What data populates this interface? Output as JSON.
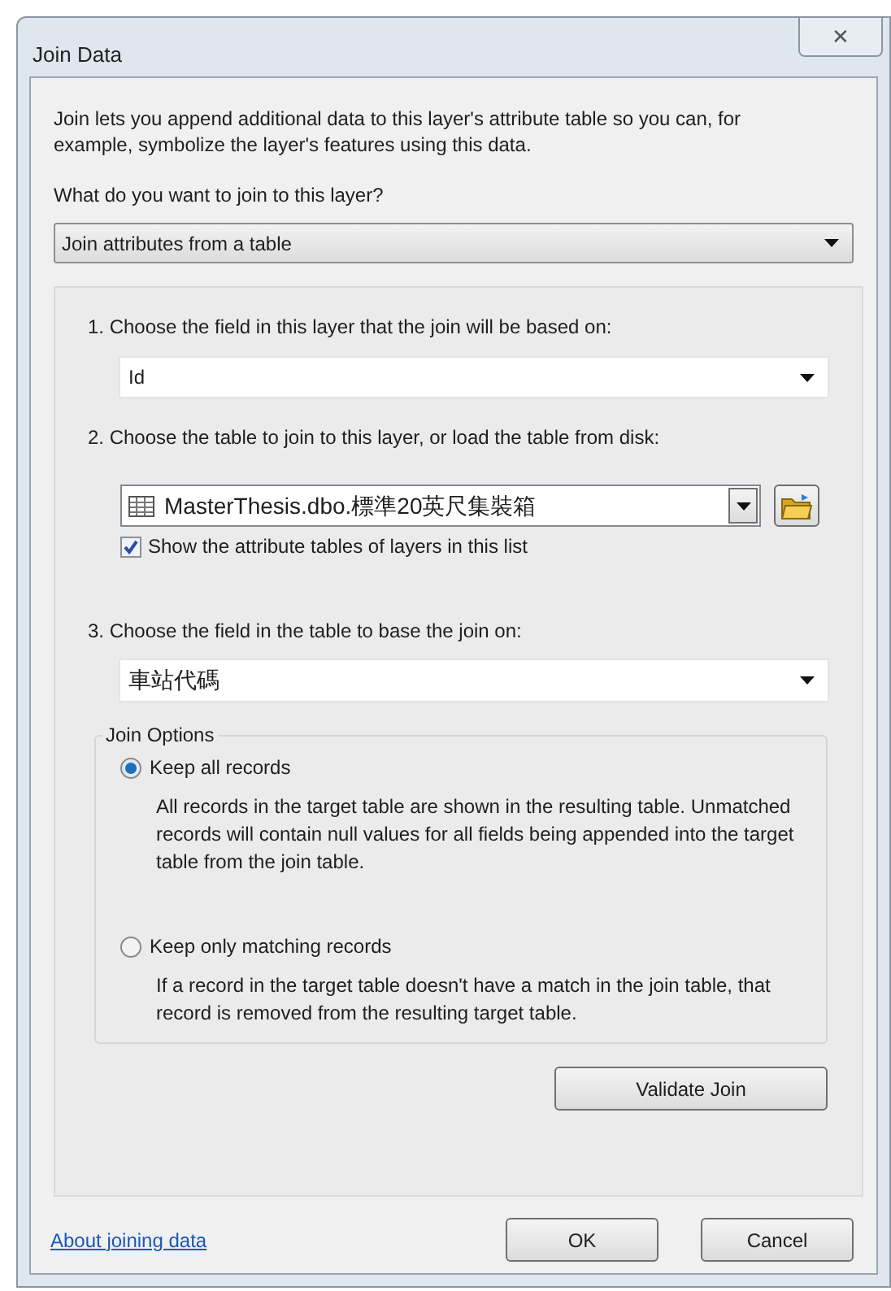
{
  "window": {
    "title": "Join Data",
    "close": "✕"
  },
  "intro": "Join lets you append additional data to this layer's attribute table so you can, for example, symbolize the layer's features using this data.",
  "join_type": {
    "label": "What do you want to join to this layer?",
    "value": "Join attributes from a table"
  },
  "step1": {
    "label": "1.  Choose the field in this layer that the join will be based on:",
    "value": "Id"
  },
  "step2": {
    "label": "2.  Choose the table to join to this layer, or load the table from disk:",
    "value": "MasterThesis.dbo.標準20英尺集裝箱",
    "show_layer_tables": {
      "label": "Show the attribute tables of layers in this list",
      "checked": true
    }
  },
  "step3": {
    "label": "3.  Choose the field in the table to base the join on:",
    "value": "車站代碼"
  },
  "join_options": {
    "title": "Join Options",
    "options": [
      {
        "label": "Keep all records",
        "description": "All records in the target table are shown in the resulting table. Unmatched records will contain null values for all fields being appended into the target table from the join table.",
        "selected": true
      },
      {
        "label": "Keep only matching records",
        "description": "If a record in the target table doesn't have a match in the join table, that record is removed from the resulting target table.",
        "selected": false
      }
    ]
  },
  "validate_button": "Validate Join",
  "help_link": "About joining data",
  "buttons": [
    "OK",
    "Cancel"
  ]
}
